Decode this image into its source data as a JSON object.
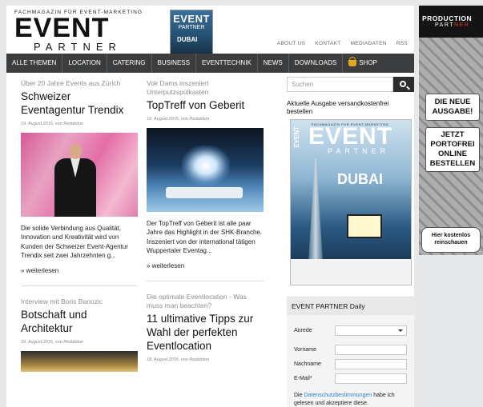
{
  "header": {
    "tagline": "FACHMAGAZIN FÜR EVENT-MARKETING",
    "logo_event": "EVENT",
    "logo_partner": "PARTNER",
    "mini_cover": {
      "title": "EVENT",
      "subtitle": "PARTNER",
      "headline": "DUBAI"
    },
    "links": [
      "ABOUT US",
      "KONTAKT",
      "MEDIADATEN",
      "RSS"
    ]
  },
  "nav": {
    "items": [
      "ALLE THEMEN",
      "LOCATION",
      "CATERING",
      "BUSINESS",
      "EVENTTECHNIK",
      "NEWS",
      "DOWNLOADS"
    ],
    "shop": "SHOP"
  },
  "articles": {
    "a1": {
      "kicker": "Über 20 Jahre Events aus Zürich",
      "title": "Schweizer Eventagentur Trendix",
      "meta": "19. August 2015, von Redaktion",
      "excerpt": "Die solide Verbindung aus Qualität, Innovation und Kreativität wird von Kunden der Schweizer Event-Agentur Trendix seit zwei Jahrzehnten g...",
      "more": "» weiterlesen"
    },
    "a2": {
      "kicker": "Vok Dams inszeniert Unterputzspülkasten",
      "title": "TopTreff von Geberit",
      "meta": "19. August 2015, von Redaktion",
      "excerpt": "Der TopTreff von Geberit ist alle paar Jahre das Highlight in der SHK-Branche. Inszeniert von der international tätigen Wuppertaler Eventag...",
      "more": "» weiterlesen"
    },
    "a3": {
      "kicker": "Interview mit Boris Banozic",
      "title": "Botschaft und Architektur",
      "meta": "19. August 2015, von Redaktion"
    },
    "a4": {
      "kicker": "Die optimale Eventlocation - Was muss man beachten?",
      "title": "11 ultimative Tipps zur Wahl der perfekten Eventlocation",
      "meta": "18. August 2015, von Redaktion"
    }
  },
  "sidebar": {
    "search_placeholder": "Suchen",
    "caption": "Aktuelle Ausgabe versandkostenfrei bestellen",
    "cover": {
      "tag": "FACHMAGAZIN FÜR EVENT-MARKETING",
      "title": "EVENT",
      "subtitle": "PARTNER",
      "spine": "EVENT",
      "headline": "DUBAI"
    },
    "daily": {
      "heading": "EVENT PARTNER Daily",
      "fields": [
        "Anrede",
        "Vorname",
        "Nachname",
        "E-Mail*"
      ],
      "privacy_prefix": "Die ",
      "privacy_link": "Datenschutzbestimmungen",
      "privacy_suffix": " habe ich gelesen und akzeptiere diese."
    }
  },
  "ad": {
    "brand_line1": "PRODUCTION",
    "brand_line2a": "PART",
    "brand_line2b": "NER",
    "box1": "DIE NEUE AUSGABE!",
    "box2": "JETZT PORTOFREI ONLINE BESTELLEN",
    "box3": "Hier kostenlos reinschauen"
  },
  "colors": {
    "nav_bg": "#3c3d3f",
    "link": "#2d7fd0",
    "kicker": "#8a8f95",
    "shop_icon": "#e8a81b"
  },
  "icons": [
    "search-icon",
    "shopping-basket-icon"
  ]
}
